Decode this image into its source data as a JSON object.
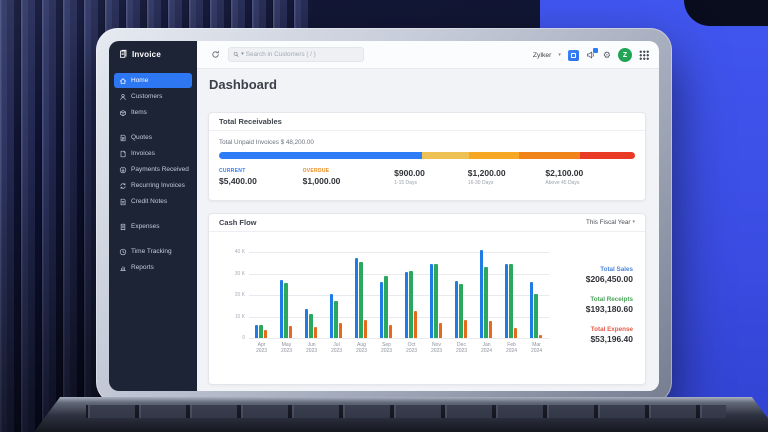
{
  "app": {
    "name": "Invoice"
  },
  "topbar": {
    "search_placeholder": "Search in Customers ( / )",
    "org_name": "Zylker",
    "avatar_initial": "Z"
  },
  "sidebar": {
    "items": [
      {
        "label": "Home",
        "icon": "home",
        "active": true,
        "gap": false
      },
      {
        "label": "Customers",
        "icon": "customers",
        "active": false,
        "gap": false
      },
      {
        "label": "Items",
        "icon": "items",
        "active": false,
        "gap": false
      },
      {
        "label": "Quotes",
        "icon": "quotes",
        "active": false,
        "gap": true
      },
      {
        "label": "Invoices",
        "icon": "invoices",
        "active": false,
        "gap": false
      },
      {
        "label": "Payments Received",
        "icon": "payments",
        "active": false,
        "gap": false
      },
      {
        "label": "Recurring Invoices",
        "icon": "recurring",
        "active": false,
        "gap": false
      },
      {
        "label": "Credit Notes",
        "icon": "credit",
        "active": false,
        "gap": false
      },
      {
        "label": "Expenses",
        "icon": "expenses",
        "active": false,
        "gap": true
      },
      {
        "label": "Time Tracking",
        "icon": "time",
        "active": false,
        "gap": true
      },
      {
        "label": "Reports",
        "icon": "reports",
        "active": false,
        "gap": false
      }
    ]
  },
  "page": {
    "title": "Dashboard"
  },
  "receivables": {
    "title": "Total Receivables",
    "unpaid_label": "Total Unpaid Invoices",
    "unpaid_value": "$ 48,200.00",
    "segments": [
      {
        "color": "#2e7cf6",
        "pct": 48.8
      },
      {
        "color": "#eec155",
        "pct": 11.4
      },
      {
        "color": "#f6a723",
        "pct": 11.9
      },
      {
        "color": "#f08418",
        "pct": 14.6
      },
      {
        "color": "#e93a25",
        "pct": 13.3
      }
    ],
    "stats": [
      {
        "label": "CURRENT",
        "label_color": "#2e7cf6",
        "value": "$5,400.00",
        "sub": ""
      },
      {
        "label": "OVERDUE",
        "label_color": "#ef8a1c",
        "value": "$1,000.00",
        "sub": ""
      },
      {
        "label": "",
        "label_color": "",
        "value": "$900.00",
        "sub": "1-15 Days"
      },
      {
        "label": "",
        "label_color": "",
        "value": "$1,200.00",
        "sub": "16-30 Days"
      },
      {
        "label": "",
        "label_color": "",
        "value": "$2,100.00",
        "sub": "Above 45 Days"
      }
    ]
  },
  "cashflow": {
    "title": "Cash Flow",
    "filter_label": "This Fiscal Year",
    "totals": [
      {
        "label": "Total Sales",
        "color": "#4d87d9",
        "value": "$206,450.00"
      },
      {
        "label": "Total Receipts",
        "color": "#4aa35a",
        "value": "$193,180.60"
      },
      {
        "label": "Total Expense",
        "color": "#e25c49",
        "value": "$53,196.40"
      }
    ]
  },
  "chart_data": {
    "type": "bar",
    "title": "Cash Flow",
    "categories": [
      "Apr 2023",
      "May 2023",
      "Jun 2023",
      "Jul 2023",
      "Aug 2023",
      "Sep 2023",
      "Oct 2023",
      "Nov 2023",
      "Dec 2023",
      "Jan 2024",
      "Feb 2024",
      "Mar 2024"
    ],
    "series": [
      {
        "name": "Sales",
        "color": "#1f7ce4",
        "values": [
          6000,
          27000,
          13500,
          20500,
          37000,
          26000,
          30500,
          34500,
          26500,
          41000,
          34500,
          26000
        ]
      },
      {
        "name": "Receipts",
        "color": "#2aa95e",
        "values": [
          6000,
          25500,
          11000,
          17000,
          35500,
          29000,
          31000,
          34500,
          25000,
          33000,
          34500,
          20500
        ]
      },
      {
        "name": "Expenses",
        "color": "#e46a1d",
        "values": [
          3500,
          5500,
          5000,
          7000,
          8500,
          6000,
          12500,
          7000,
          8500,
          8000,
          4500,
          1500
        ]
      }
    ],
    "ylim": [
      0,
      40000
    ],
    "yticks": [
      {
        "v": 40000,
        "label": "40 K"
      },
      {
        "v": 30000,
        "label": "30 K"
      },
      {
        "v": 20000,
        "label": "20 K"
      },
      {
        "v": 10000,
        "label": "10 K"
      },
      {
        "v": 0,
        "label": "0"
      }
    ],
    "grid": true,
    "legend": false
  }
}
